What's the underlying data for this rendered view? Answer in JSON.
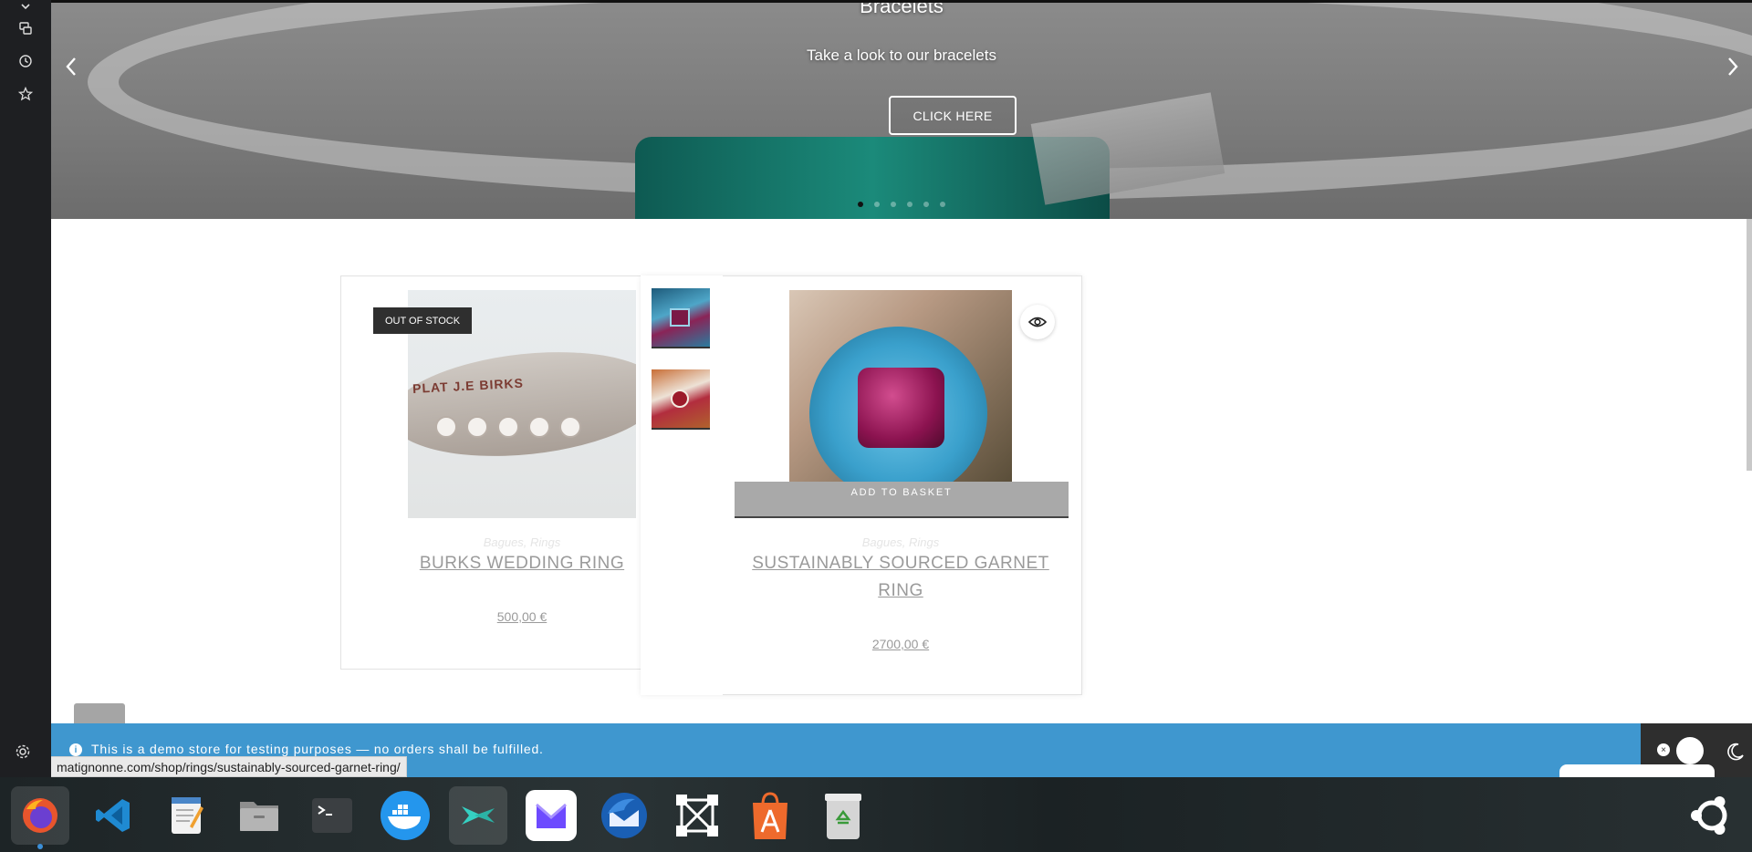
{
  "browser": {
    "status_url": "matignonne.com/shop/rings/sustainably-sourced-garnet-ring/"
  },
  "hero": {
    "title": "Bracelets",
    "subtitle": "Take a look to our bracelets",
    "button_label": "CLICK HERE",
    "prev_icon": "chevron-left-icon",
    "next_icon": "chevron-right-icon",
    "slide_count": 6,
    "active_slide": 1
  },
  "products": [
    {
      "badge": "OUT OF STOCK",
      "categories": "Bagues, Rings",
      "title": "BURKS WEDDING RING",
      "price": "500,00 €"
    },
    {
      "categories": "Bagues, Rings",
      "title": "SUSTAINABLY SOURCED GARNET RING",
      "price": "2700,00 €",
      "add_to_basket": "ADD TO BASKET",
      "quick_view_icon": "eye-icon"
    }
  ],
  "notice": {
    "text": "This is a demo store for testing purposes — no orders shall be fulfilled."
  },
  "taskbar": {
    "apps": [
      "firefox-icon",
      "vscode-icon",
      "text-editor-icon",
      "files-icon",
      "terminal-icon",
      "docker-icon",
      "kite-icon",
      "proton-mail-icon",
      "thunderbird-icon",
      "inkscape-icon",
      "app-store-icon",
      "trash-icon",
      "ubuntu-icon"
    ]
  },
  "colors": {
    "notice_bg": "#3f97cf",
    "badge_bg": "#2f2f2f",
    "sidebar_bg": "#1e1f22"
  }
}
